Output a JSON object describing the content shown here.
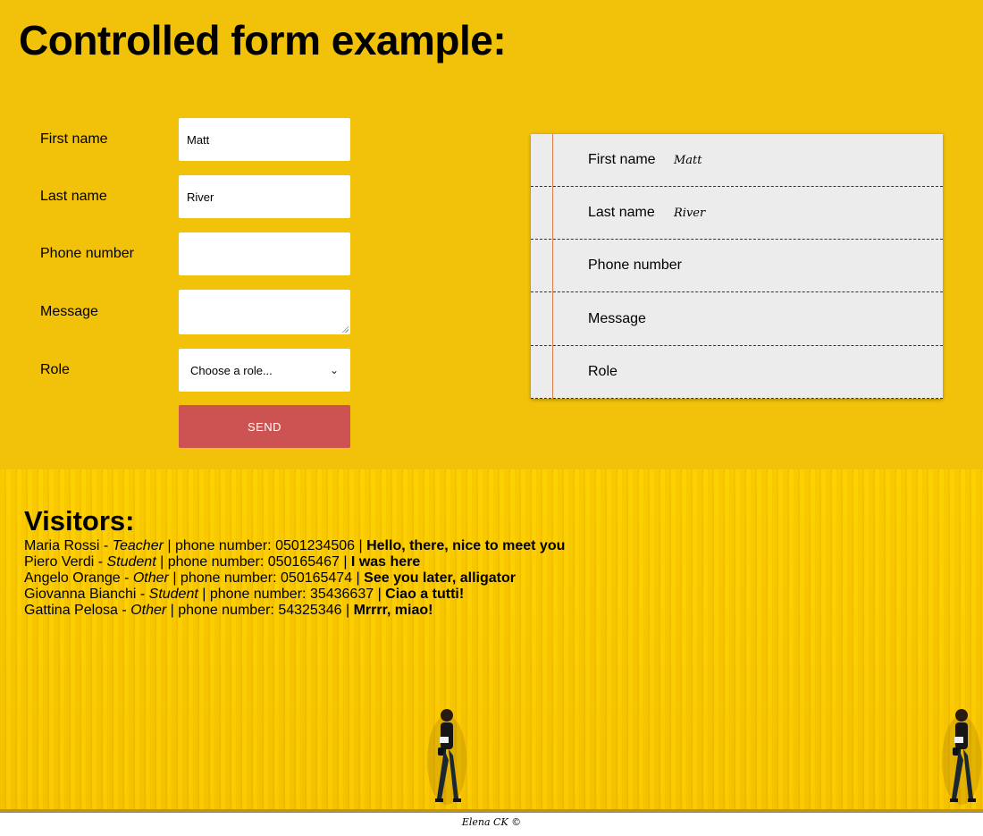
{
  "page": {
    "title": "Controlled form example:"
  },
  "form": {
    "fields": [
      {
        "label": "First name",
        "value": "Matt"
      },
      {
        "label": "Last name",
        "value": "River"
      },
      {
        "label": "Phone number",
        "value": ""
      },
      {
        "label": "Message",
        "value": ""
      }
    ],
    "role": {
      "label": "Role",
      "selected": "Choose a role..."
    },
    "send_label": "SEND"
  },
  "preview": {
    "rows": [
      {
        "label": "First name",
        "value": "Matt"
      },
      {
        "label": "Last name",
        "value": "River"
      },
      {
        "label": "Phone number",
        "value": ""
      },
      {
        "label": "Message",
        "value": ""
      },
      {
        "label": "Role",
        "value": ""
      }
    ]
  },
  "visitors": {
    "heading": "Visitors:",
    "phone_label": "phone number:",
    "items": [
      {
        "name": "Maria Rossi",
        "role": "Teacher",
        "phone": "0501234506",
        "message": "Hello, there, nice to meet you"
      },
      {
        "name": "Piero Verdi",
        "role": "Student",
        "phone": "050165467",
        "message": "I was here"
      },
      {
        "name": "Angelo Orange",
        "role": "Other",
        "phone": "050165474",
        "message": "See you later, alligator"
      },
      {
        "name": "Giovanna Bianchi",
        "role": "Student",
        "phone": "35436637",
        "message": "Ciao a tutti!"
      },
      {
        "name": "Gattina Pelosa",
        "role": "Other",
        "phone": "54325346",
        "message": "Mrrrr, miao!"
      }
    ]
  },
  "footer": {
    "text": "Elena CK ©"
  },
  "colors": {
    "background": "#f2c20a",
    "send_button": "#cd5252",
    "card": "#ececec",
    "margin_line": "#d9804a"
  }
}
